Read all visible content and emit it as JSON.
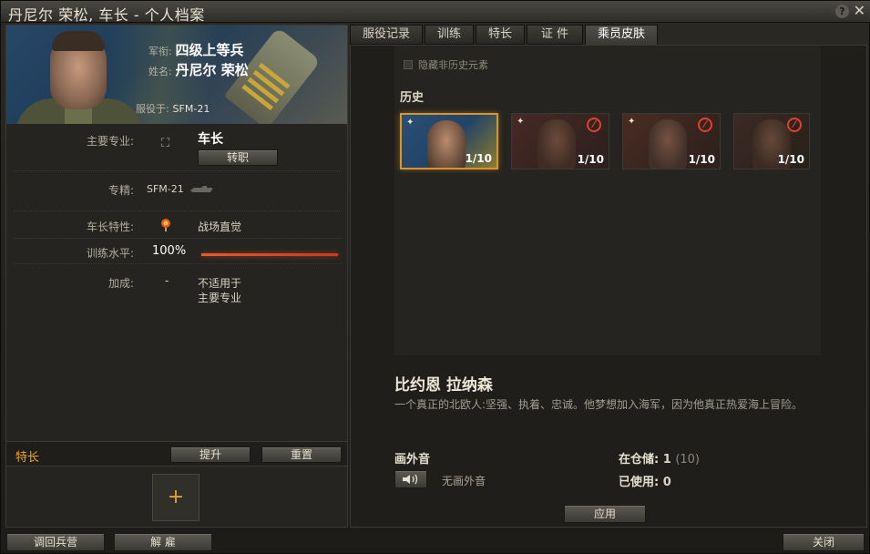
{
  "window": {
    "title": "丹尼尔 荣松, 车长 - 个人档案",
    "help_icon": "?",
    "close_icon": "✕"
  },
  "portrait": {
    "rank_label": "军衔:",
    "rank_value": "四级上等兵",
    "name_label": "姓名:",
    "name_value": "丹尼尔 荣松",
    "serving_label": "服役于:",
    "serving_value": "SFM-21"
  },
  "attributes": {
    "specialty_label": "主要专业:",
    "specialty_value": "车长",
    "retrain_button": "转职",
    "vehicle_label": "专精:",
    "vehicle_value": "SFM-21",
    "trait_label": "车长特性:",
    "trait_value": "战场直觉",
    "training_label": "训练水平:",
    "training_value": "100%",
    "training_progress": 1.0,
    "bonus_label": "加成:",
    "bonus_value": "-",
    "bonus_note_1": "不适用于",
    "bonus_note_2": "主要专业"
  },
  "perks": {
    "label": "特长",
    "raise_button": "提升",
    "reset_button": "重置",
    "add_symbol": "+"
  },
  "tabs": [
    {
      "label": "服役记录"
    },
    {
      "label": "训练"
    },
    {
      "label": "特长"
    },
    {
      "label": "证 件"
    },
    {
      "label": "乘员皮肤"
    }
  ],
  "skins": {
    "hide_nonhistorical": "隐藏非历史元素",
    "section_label": "历史",
    "items": [
      {
        "count": "1/10",
        "locked": false
      },
      {
        "count": "1/10",
        "locked": true
      },
      {
        "count": "1/10",
        "locked": true
      },
      {
        "count": "1/10",
        "locked": true
      }
    ],
    "pin_symbol": "✦",
    "lock_symbol": "⃠"
  },
  "selected_skin": {
    "name": "比约恩 拉纳森",
    "description": "一个真正的北欧人:坚强、执着、忠诚。他梦想加入海军，因为他真正热爱海上冒险。"
  },
  "voiceover": {
    "label": "画外音",
    "value": "无画外音",
    "speaker_symbol": "🔊"
  },
  "stock": {
    "in_storage_label": "在仓储:",
    "in_storage_value": "1",
    "in_storage_total": "(10)",
    "used_label": "已使用:",
    "used_value": "0"
  },
  "apply_button": "应用",
  "footer": {
    "barracks_button": "调回兵营",
    "dismiss_button": "解 雇",
    "close_button": "关闭"
  },
  "colors": {
    "accent_orange": "#f0a520",
    "selected_border": "#d6962c",
    "locked_red": "#e0422f"
  }
}
